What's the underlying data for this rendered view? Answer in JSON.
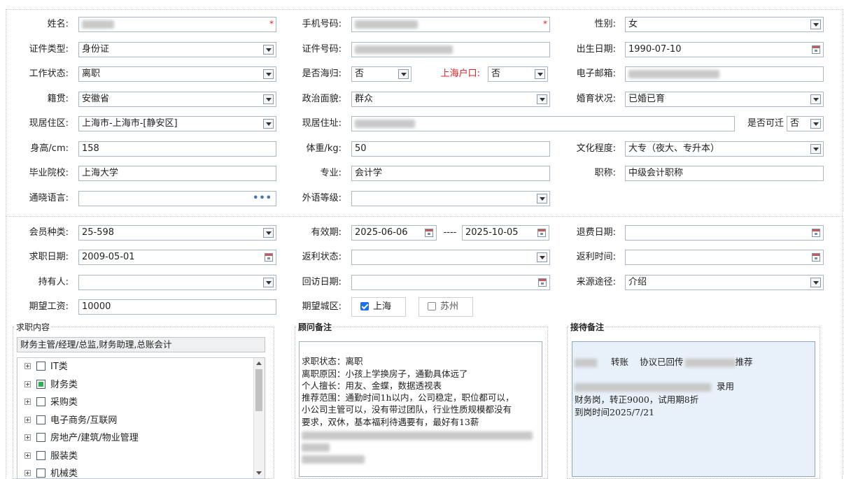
{
  "personal": {
    "name": {
      "label": "姓名:"
    },
    "phone": {
      "label": "手机号码:"
    },
    "gender": {
      "label": "性别:",
      "value": "女"
    },
    "id_type": {
      "label": "证件类型:",
      "value": "身份证"
    },
    "id_number": {
      "label": "证件号码:"
    },
    "birth_date": {
      "label": "出生日期:",
      "value": "1990-07-10"
    },
    "work_status": {
      "label": "工作状态:",
      "value": "离职"
    },
    "returnee": {
      "label": "是否海归:",
      "value": "否"
    },
    "shanghai_hukou": {
      "label": "上海户口:",
      "value": "否"
    },
    "email": {
      "label": "电子邮箱:"
    },
    "native_place": {
      "label": "籍贯:",
      "value": "安徽省"
    },
    "political_status": {
      "label": "政治面貌:",
      "value": "群众"
    },
    "marital_status": {
      "label": "婚育状况:",
      "value": "已婚已育"
    },
    "residence_area": {
      "label": "现居住区:",
      "value": "上海市-上海市-[静安区]"
    },
    "address": {
      "label": "现居住址:"
    },
    "relocatable": {
      "label": "是否可迁",
      "value": "否"
    },
    "height": {
      "label": "身高/cm:",
      "value": "158"
    },
    "weight": {
      "label": "体重/kg:",
      "value": "50"
    },
    "education": {
      "label": "文化程度:",
      "value": "大专（夜大、专升本）"
    },
    "school": {
      "label": "毕业院校:",
      "value": "上海大学"
    },
    "major": {
      "label": "专业:",
      "value": "会计学"
    },
    "title": {
      "label": "职称:",
      "value": "中级会计职称"
    },
    "languages": {
      "label": "通晓语言:",
      "value": ""
    },
    "foreign_level": {
      "label": "外语等级:",
      "value": ""
    }
  },
  "membership": {
    "member_type": {
      "label": "会员种类:",
      "value": "25-598"
    },
    "valid_period": {
      "label": "有效期:",
      "start": "2025-06-06",
      "separator": "----",
      "end": "2025-10-05"
    },
    "refund_date": {
      "label": "退费日期:",
      "value": ""
    },
    "job_seek_date": {
      "label": "求职日期:",
      "value": "2009-05-01"
    },
    "rebate_status": {
      "label": "返利状态:",
      "value": ""
    },
    "rebate_time": {
      "label": "返利时间:",
      "value": ""
    },
    "holder": {
      "label": "持有人:",
      "value": ""
    },
    "visit_date": {
      "label": "回访日期:",
      "value": ""
    },
    "source": {
      "label": "来源途径:",
      "value": "介绍"
    },
    "expected_salary": {
      "label": "期望工资:",
      "value": "10000"
    },
    "expected_city": {
      "label": "期望城区:",
      "options": [
        {
          "label": "上海",
          "checked": true
        },
        {
          "label": "苏州",
          "checked": false
        }
      ]
    }
  },
  "job_content": {
    "legend": "求职内容",
    "summary": "财务主管/经理/总监,财务助理,总账会计",
    "tree": [
      {
        "label": "IT类",
        "state": "unchecked"
      },
      {
        "label": "财务类",
        "state": "partial"
      },
      {
        "label": "采购类",
        "state": "unchecked"
      },
      {
        "label": "电子商务/互联网",
        "state": "unchecked"
      },
      {
        "label": "房地产/建筑/物业管理",
        "state": "unchecked"
      },
      {
        "label": "服装类",
        "state": "unchecked"
      },
      {
        "label": "机械类",
        "state": "unchecked"
      }
    ]
  },
  "consultant_notes": {
    "legend": "顾问备注",
    "lines": [
      "求职状态：离职",
      "离职原因：小孩上学换房子，通勤具体远了",
      "个人擅长：用友、金蝶，数据透视表",
      "推荐范围：通勤时间1h以内，公司稳定，职位都可以，",
      "小公司主管可以，没有带过团队，行业性质规模都没有",
      "要求，双休，基本福利待遇要有，最好有13薪"
    ]
  },
  "reception_notes": {
    "legend": "接待备注",
    "line1_a": "转账",
    "line1_b": "协议已回传",
    "line1_c": "推荐",
    "line2": "录用",
    "line3": "财务岗，转正9000，试用期8折",
    "line4": "到岗时间2025/7/21"
  }
}
